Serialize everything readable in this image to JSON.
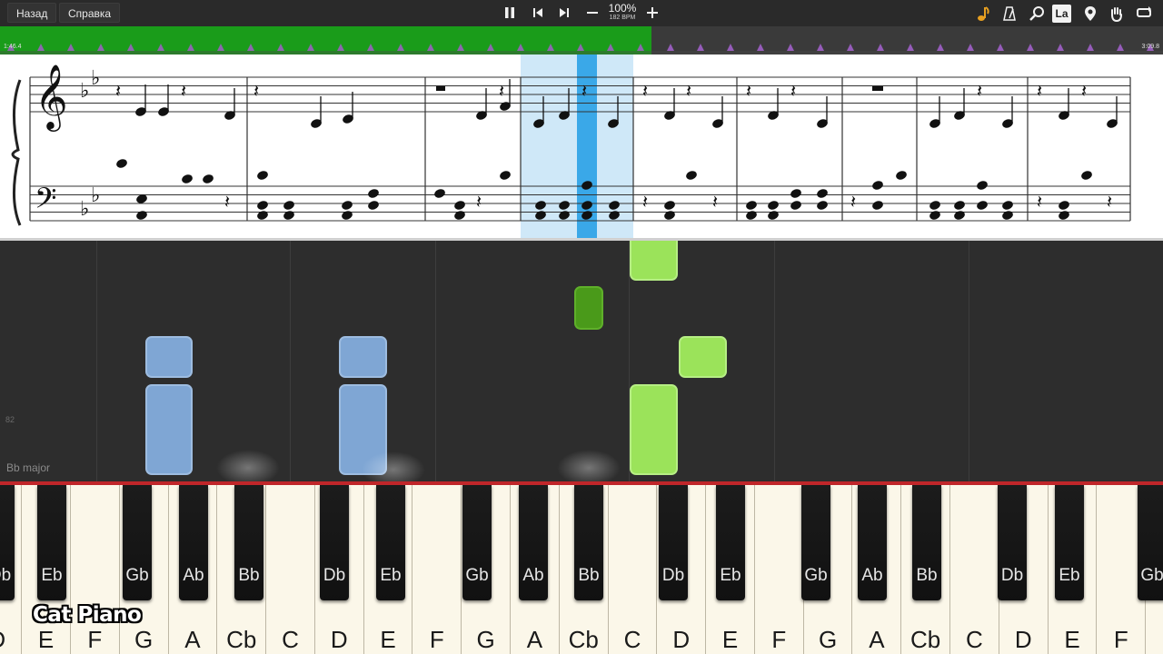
{
  "toolbar": {
    "back_label": "Назад",
    "help_label": "Справка",
    "zoom_percent": "100%",
    "bpm_label": "182 BPM",
    "instrument_label": "La"
  },
  "timeline": {
    "elapsed": "1:46.4",
    "total": "3:09.8",
    "progress": 0.56,
    "colors": {
      "played": "#1a9c1a",
      "remaining": "#3a3a3a",
      "marker": "#a060c8"
    }
  },
  "roll": {
    "measure_number": "82",
    "key_signature": "Bb major",
    "colors": {
      "left_hand": "#7fa6d4",
      "right_hand": "#9be35a",
      "current": "#4a9a1a"
    }
  },
  "piano": {
    "white_keys": [
      "D",
      "E",
      "F",
      "G",
      "A",
      "Cb",
      "C",
      "D",
      "E",
      "F",
      "G",
      "A",
      "Cb",
      "C",
      "D",
      "E",
      "F",
      "G",
      "A",
      "Cb",
      "C",
      "D",
      "E",
      "F"
    ],
    "black_keys": [
      "Db",
      "Eb",
      "Gb",
      "Ab",
      "Bb",
      "Db",
      "Eb",
      "Gb",
      "Ab",
      "Bb",
      "Db",
      "Eb",
      "Gb",
      "Ab",
      "Bb",
      "Db",
      "Eb",
      "Gb"
    ],
    "accent_color": "#c0262a"
  },
  "brand": {
    "text": "Cat Piano"
  }
}
